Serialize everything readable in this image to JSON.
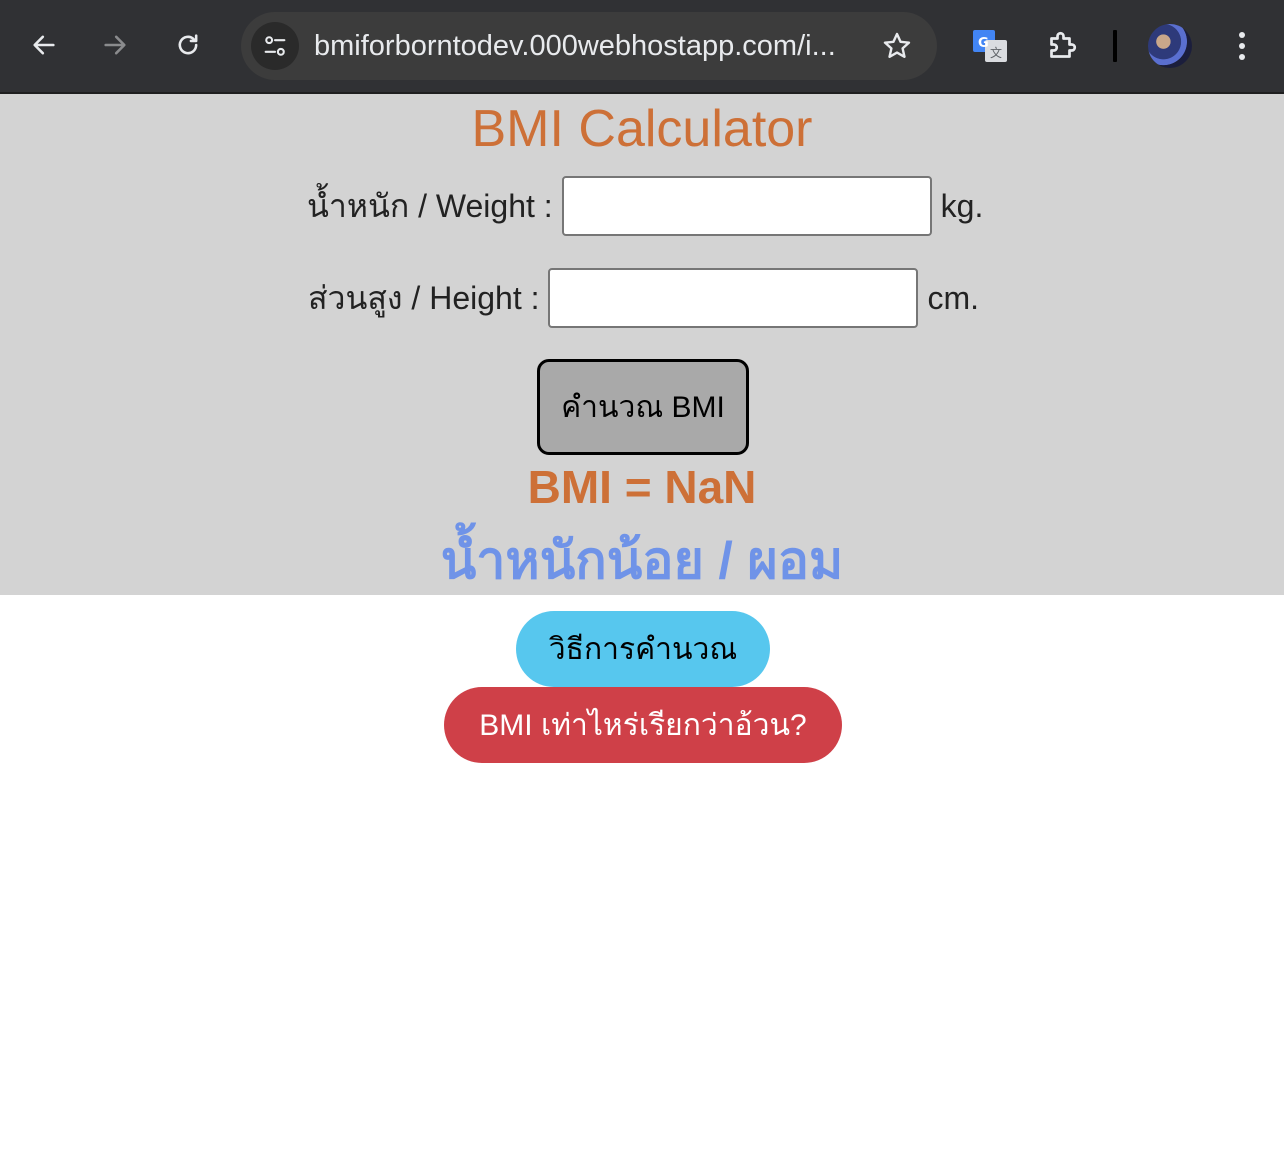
{
  "browser": {
    "url": "bmiforborntodev.000webhostapp.com/i...",
    "icons": {
      "back": "back-arrow-icon",
      "forward": "forward-arrow-icon",
      "reload": "reload-icon",
      "site_info": "tune-icon",
      "bookmark": "star-icon",
      "translate": "google-translate-icon",
      "extensions": "puzzle-icon",
      "profile": "avatar",
      "menu": "kebab-menu-icon"
    }
  },
  "calculator": {
    "title": "BMI Calculator",
    "weight_label": "น้ำหนัก / Weight :",
    "weight_value": "",
    "weight_unit": "kg.",
    "height_label": "ส่วนสูง / Height :",
    "height_value": "",
    "height_unit": "cm.",
    "calculate_button": "คำนวณ BMI",
    "result_text": "BMI = NaN",
    "category_text": "น้ำหนักน้อย / ผอม"
  },
  "buttons": {
    "how_to_calculate": "วิธีการคำนวณ",
    "what_bmi_is_fat": "BMI เท่าไหร่เรียกว่าอ้วน?"
  },
  "colors": {
    "title": "#cd7037",
    "result": "#cd7037",
    "category": "#6f93e8",
    "panel_bg": "#d3d3d3",
    "how_button": "#57c7ee",
    "what_button": "#cf4048",
    "calc_button": "#a9a9a9"
  }
}
